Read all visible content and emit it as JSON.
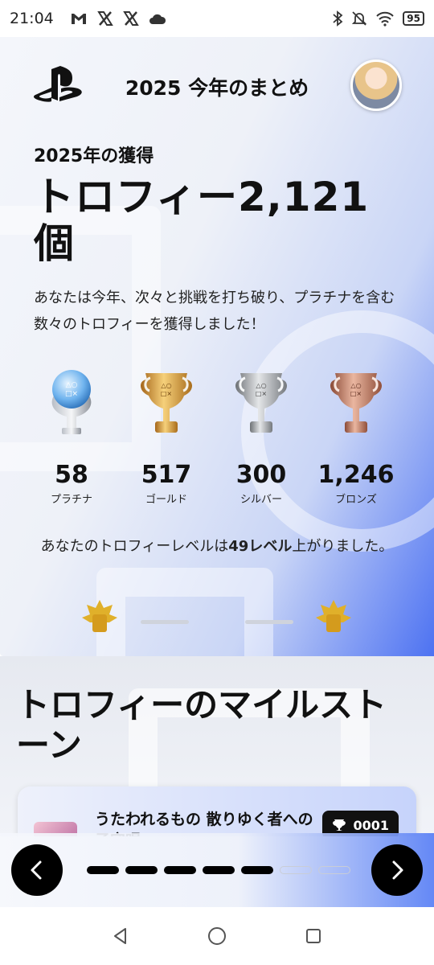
{
  "status_bar": {
    "time": "21:04",
    "battery": "95",
    "left_icons": [
      "gmail-icon",
      "x-icon",
      "x-icon",
      "cloud-icon"
    ],
    "right_icons": [
      "bluetooth-icon",
      "bell-off-icon",
      "wifi-icon",
      "battery-icon"
    ]
  },
  "header": {
    "title": "2025 今年のまとめ",
    "logo": "playstation-logo-icon",
    "avatar": "user-avatar"
  },
  "summary": {
    "year_label": "2025年の獲得",
    "trophy_total": "トロフィー2,121個",
    "description": "あなたは今年、次々と挑戦を打ち破り、プラチナを含む数々のトロフィーを獲得しました！"
  },
  "trophies": [
    {
      "count": "58",
      "label": "プラチナ",
      "icon": "platinum-trophy-icon"
    },
    {
      "count": "517",
      "label": "ゴールド",
      "icon": "gold-trophy-icon"
    },
    {
      "count": "300",
      "label": "シルバー",
      "icon": "silver-trophy-icon"
    },
    {
      "count": "1,246",
      "label": "ブロンズ",
      "icon": "bronze-trophy-icon"
    }
  ],
  "level": {
    "text_before": "あなたのトロフィーレベルは",
    "highlight": "49レベル",
    "text_after": "上がりました。"
  },
  "milestone": {
    "title": "トロフィーのマイルストーン",
    "game_title": "うたわれるもの 散りゆく者への子守唄",
    "trophy_number": "0001"
  },
  "pager": {
    "total_pages": 7,
    "active_pages": 5,
    "prev_icon": "chevron-left-icon",
    "next_icon": "chevron-right-icon"
  },
  "colors": {
    "accent_blue": "#4d72f2",
    "platinum": "#9fc6f0",
    "gold": "#d79a2b",
    "silver": "#a7a9ad",
    "bronze": "#c4806a"
  }
}
